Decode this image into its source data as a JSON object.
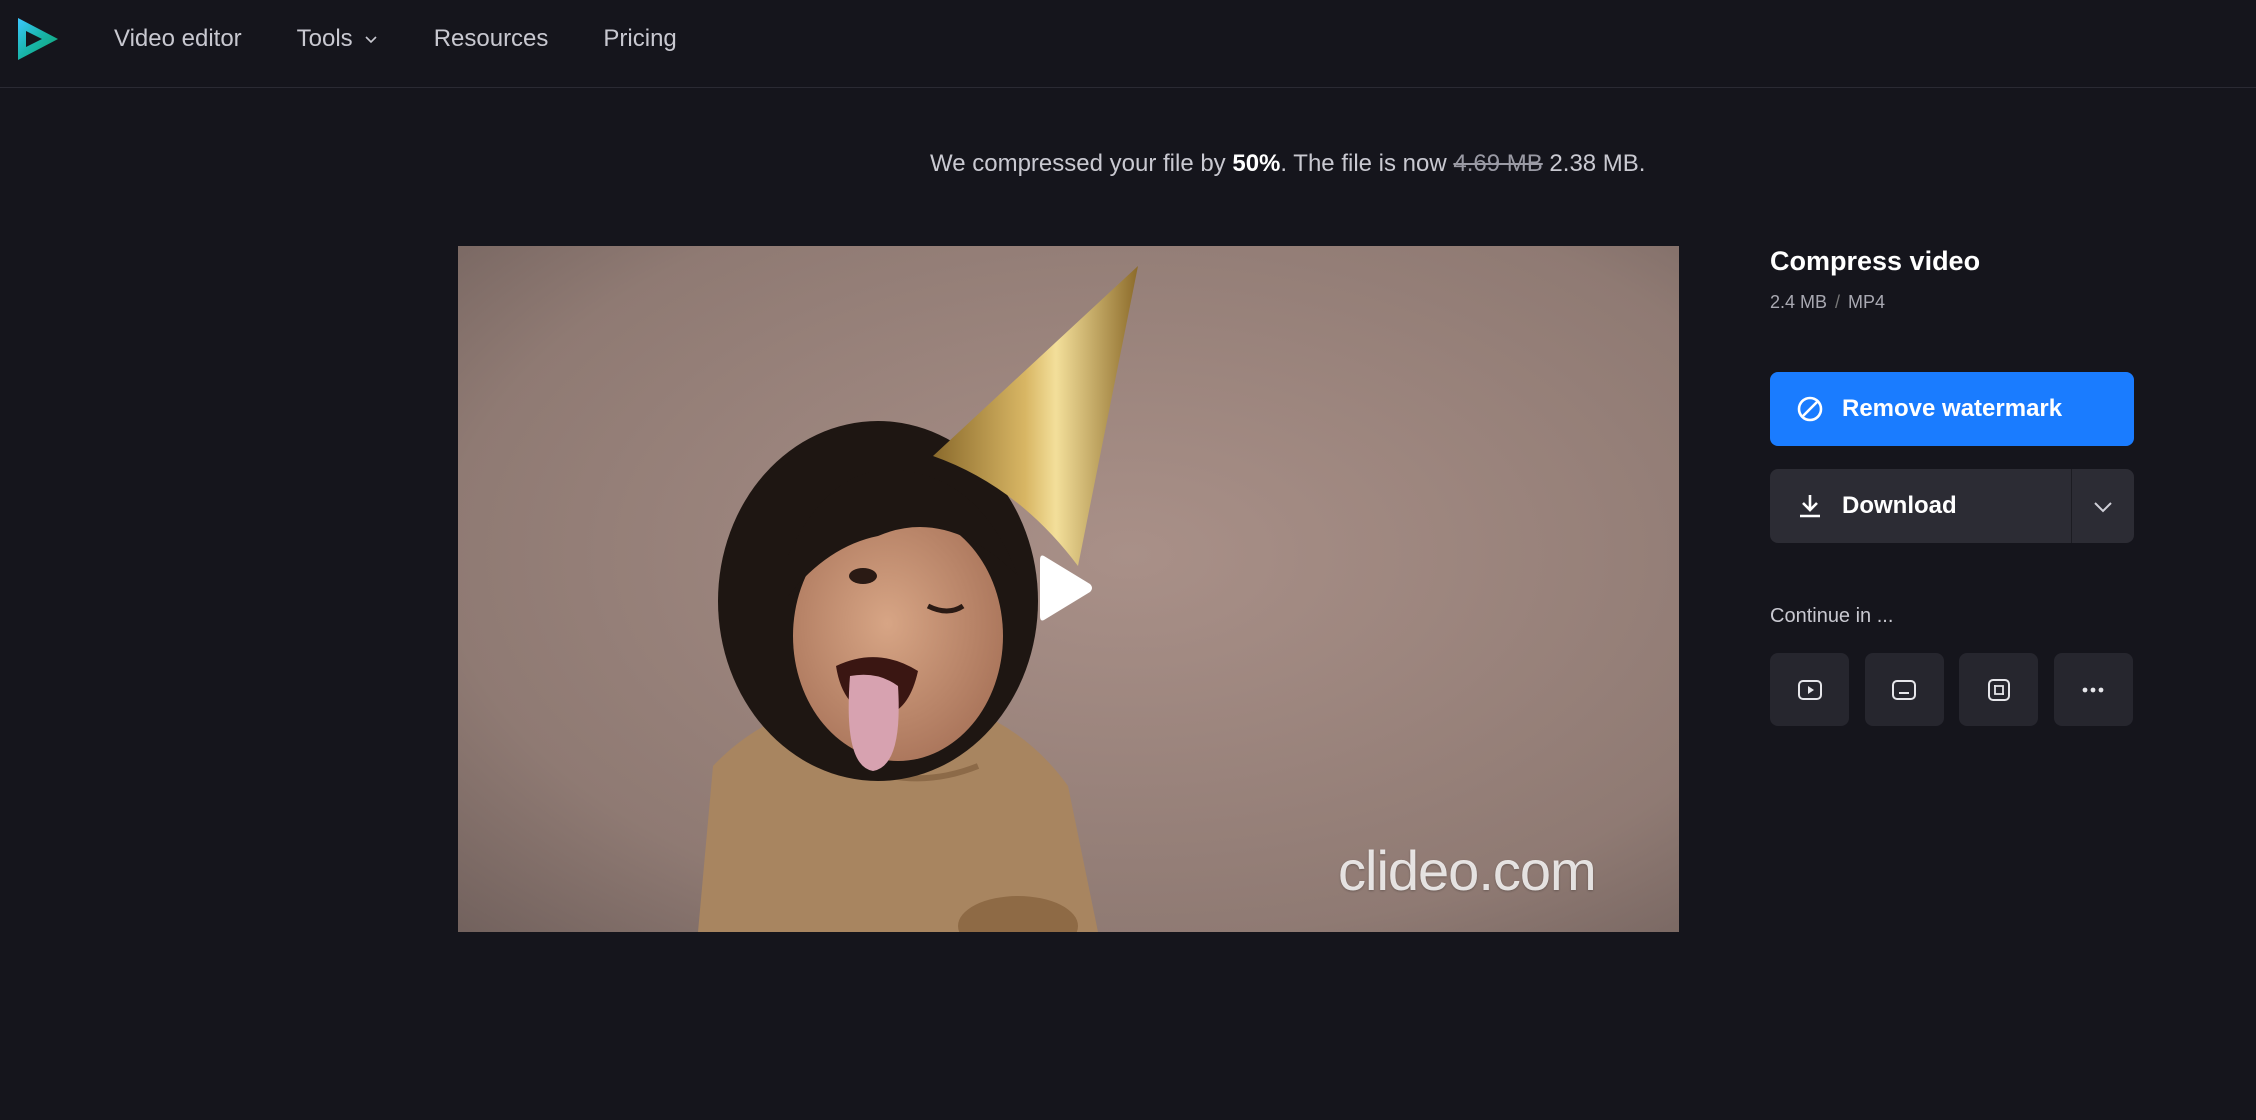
{
  "nav": {
    "items": [
      {
        "label": "Video editor"
      },
      {
        "label": "Tools"
      },
      {
        "label": "Resources"
      },
      {
        "label": "Pricing"
      }
    ]
  },
  "status": {
    "prefix": "We compressed your file by ",
    "percent": "50%",
    "middle": ". The file is now ",
    "old_size": "4.69 MB",
    "new_size": "2.38 MB."
  },
  "video": {
    "watermark": "clideo.com"
  },
  "panel": {
    "title": "Compress video",
    "size": "2.4 MB",
    "separator": "/",
    "format": "MP4",
    "remove_watermark_label": "Remove watermark",
    "download_label": "Download",
    "continue_label": "Continue in ..."
  },
  "colors": {
    "background": "#15151c",
    "accent": "#1a7cff",
    "button_dark": "#2c2c34"
  },
  "icons": {
    "logo": "clideo-logo",
    "play": "play-icon",
    "remove_watermark": "block-icon",
    "download": "download-icon",
    "continue": [
      "video-player-icon",
      "subtitles-icon",
      "crop-icon",
      "more-icon"
    ]
  }
}
